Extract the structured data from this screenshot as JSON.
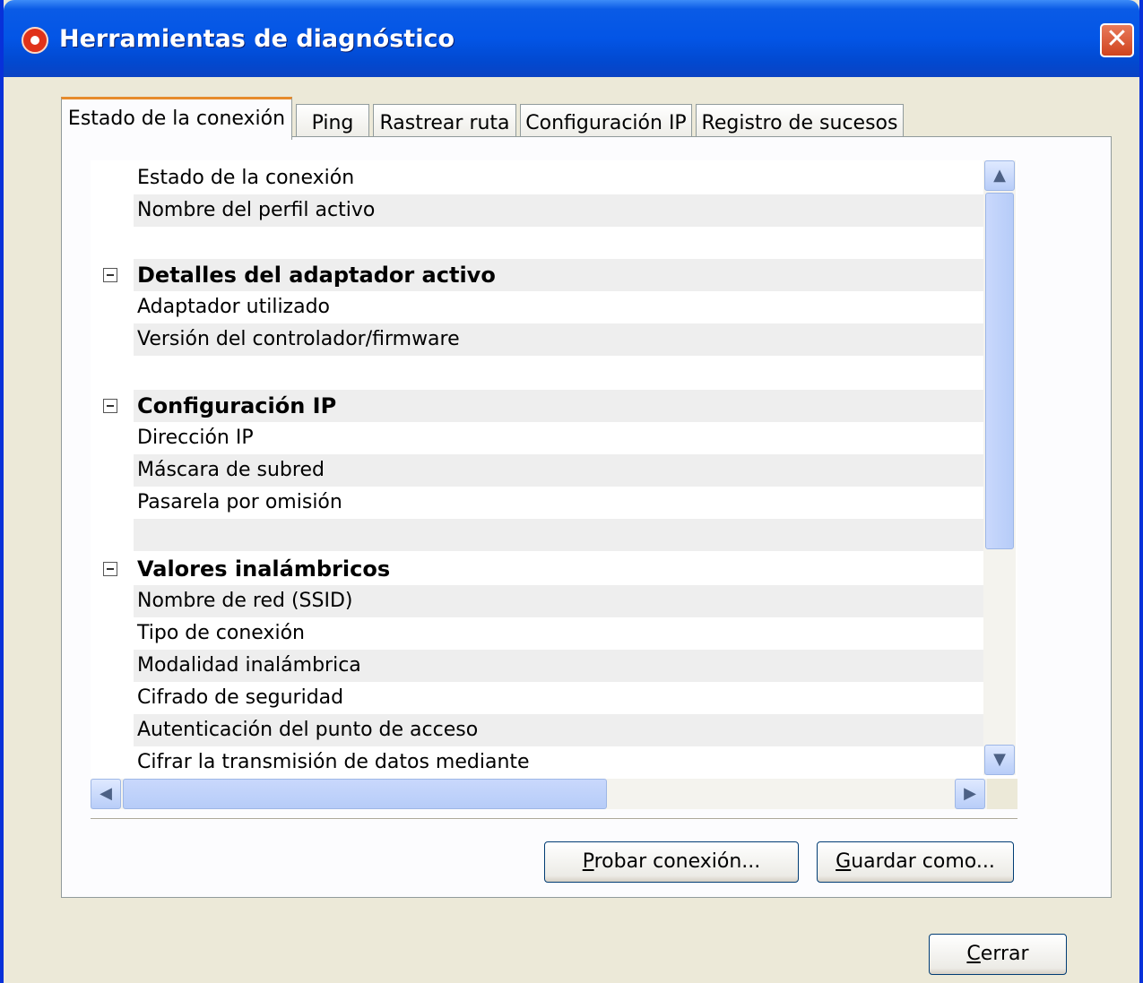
{
  "window": {
    "title": "Herramientas de diagnóstico",
    "close_label": "✕"
  },
  "tabs": [
    {
      "label": "Estado de la conexión",
      "active": true
    },
    {
      "label": "Ping"
    },
    {
      "label": "Rastrear ruta"
    },
    {
      "label": "Configuración IP"
    },
    {
      "label": "Registro de sucesos"
    }
  ],
  "rows": [
    {
      "label": "Estado de la conexión"
    },
    {
      "label": "Nombre del perfil activo"
    },
    {
      "label": ""
    },
    {
      "label": "Detalles del adaptador activo",
      "header": true
    },
    {
      "label": "Adaptador utilizado"
    },
    {
      "label": "Versión del controlador/firmware"
    },
    {
      "label": ""
    },
    {
      "label": "Configuración IP",
      "header": true
    },
    {
      "label": "Dirección IP"
    },
    {
      "label": "Máscara de subred"
    },
    {
      "label": "Pasarela por omisión"
    },
    {
      "label": ""
    },
    {
      "label": "Valores inalámbricos",
      "header": true
    },
    {
      "label": "Nombre de red (SSID)"
    },
    {
      "label": "Tipo de conexión"
    },
    {
      "label": "Modalidad inalámbrica"
    },
    {
      "label": "Cifrado de seguridad"
    },
    {
      "label": "Autenticación del punto de acceso"
    },
    {
      "label": "Cifrar la transmisión de datos mediante"
    }
  ],
  "scrollbar": {
    "up": "▲",
    "down": "▼",
    "left": "◀",
    "right": "▶"
  },
  "buttons": {
    "test_first": "P",
    "test_rest": "robar conexión...",
    "save_first": "G",
    "save_rest": "uardar como...",
    "close_first": "C",
    "close_rest": "errar"
  }
}
